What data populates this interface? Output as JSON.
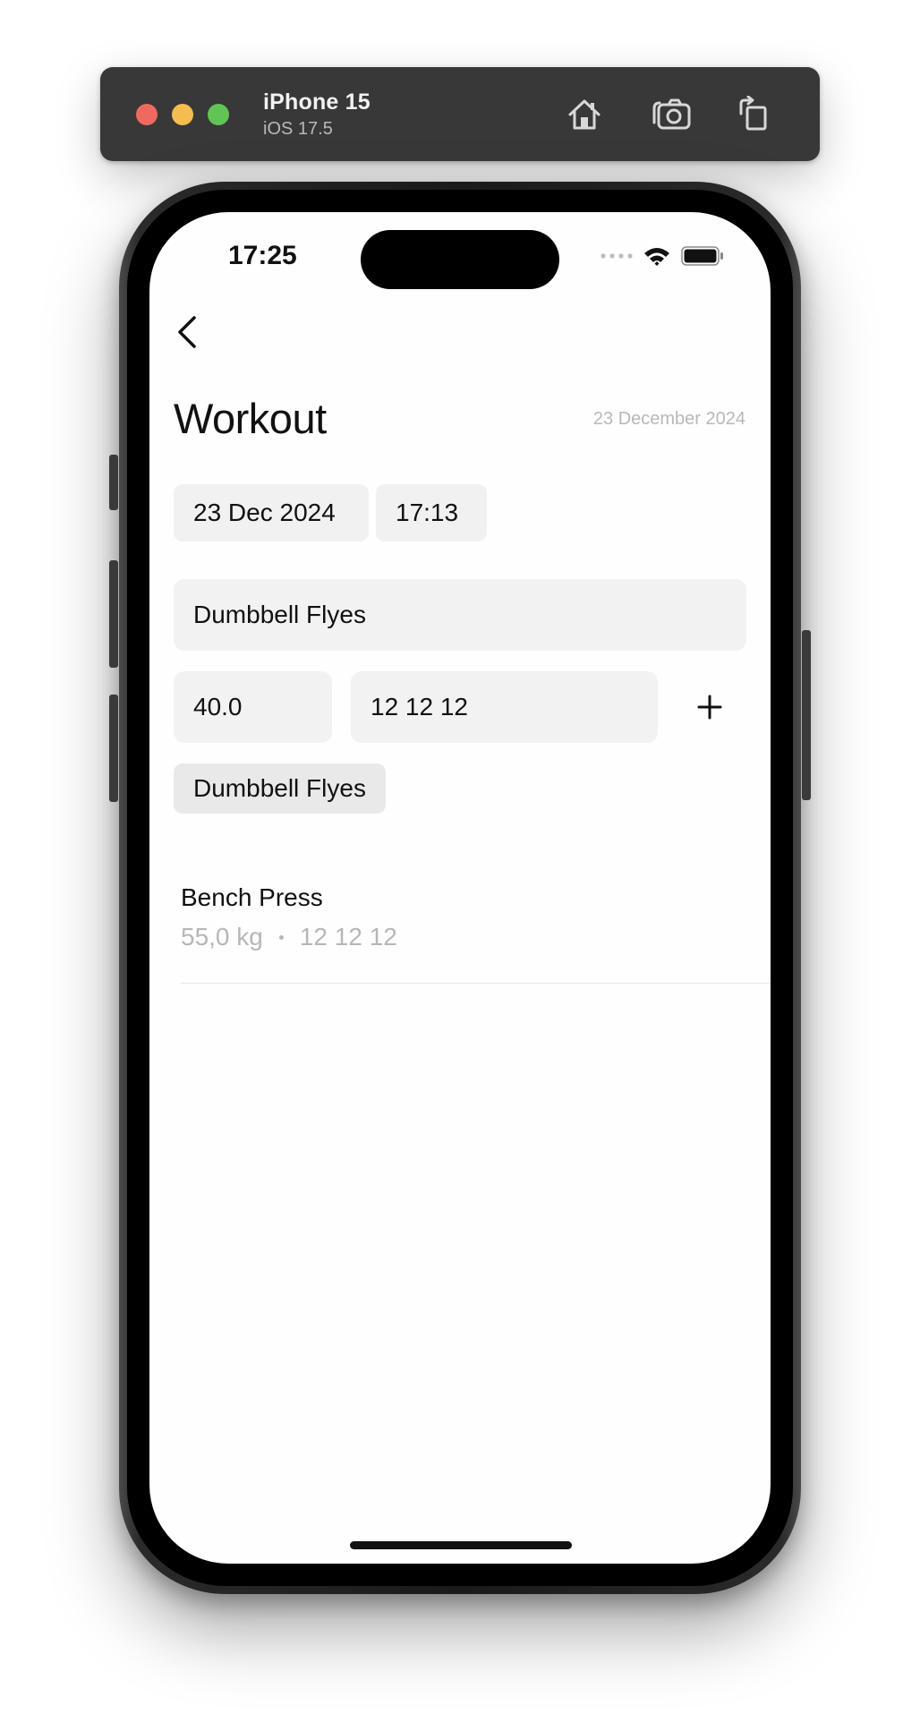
{
  "simulator": {
    "device_name": "iPhone 15",
    "os_version": "iOS 17.5",
    "buttons": {
      "home": "home-icon",
      "screenshot": "camera-icon",
      "rotate": "rotate-icon"
    }
  },
  "status_bar": {
    "time": "17:25",
    "icons": [
      "signal-dots-icon",
      "wifi-icon",
      "battery-icon"
    ]
  },
  "header": {
    "back_icon": "chevron-left-icon",
    "title": "Workout",
    "date": "23 December 2024"
  },
  "session": {
    "date_chip": "23 Dec 2024",
    "time_chip": "17:13"
  },
  "form": {
    "exercise_value": "Dumbbell Flyes",
    "weight_value": "40.0",
    "reps_value": "12 12 12",
    "add_icon": "plus-icon"
  },
  "suggestion": {
    "label": "Dumbbell Flyes"
  },
  "entries": [
    {
      "name": "Bench Press",
      "weight": "55,0 kg",
      "reps": "12 12 12"
    }
  ],
  "colors": {
    "window_bar": "#383838",
    "traffic_red": "#ee6a5e",
    "traffic_yellow": "#f5bd4f",
    "traffic_green": "#61c454",
    "field_bg": "#f2f2f2",
    "secondary_text": "#b7b7b7"
  }
}
